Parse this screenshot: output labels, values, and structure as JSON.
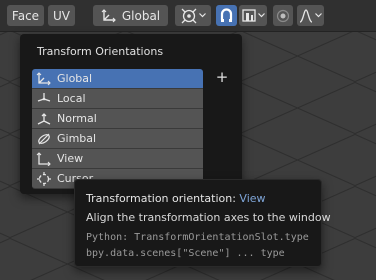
{
  "header": {
    "face_label": "Face",
    "uv_label": "UV",
    "orientation_label": "Global"
  },
  "menu": {
    "title": "Transform Orientations",
    "add_label": "+",
    "items": [
      {
        "label": "Global",
        "icon": "global-orientation-icon",
        "selected": true
      },
      {
        "label": "Local",
        "icon": "local-orientation-icon"
      },
      {
        "label": "Normal",
        "icon": "normal-orientation-icon"
      },
      {
        "label": "Gimbal",
        "icon": "gimbal-orientation-icon"
      },
      {
        "label": "View",
        "icon": "view-orientation-icon"
      },
      {
        "label": "Cursor",
        "icon": "cursor-orientation-icon"
      }
    ]
  },
  "tooltip": {
    "title": "Transformation orientation:",
    "value": "View",
    "description": "Align the transformation axes to the window",
    "python_line1": "Python: TransformOrientationSlot.type",
    "python_line2": "bpy.data.scenes[\"Scene\"] ... type"
  },
  "colors": {
    "accent": "#4772b3",
    "highlight_text": "#7fa6d9",
    "button_bg": "#545454",
    "menu_bg": "#181818"
  }
}
